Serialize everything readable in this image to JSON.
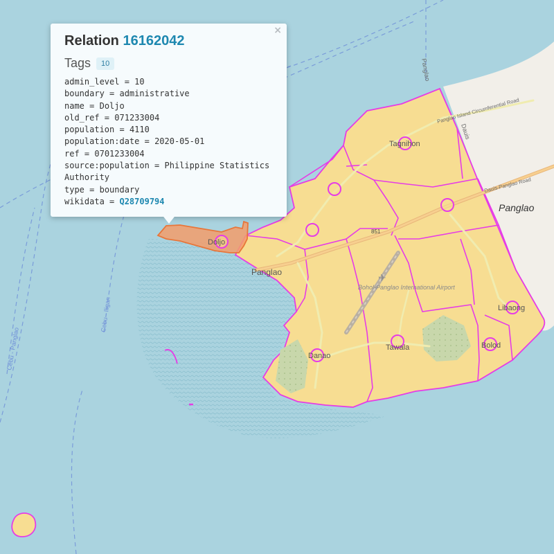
{
  "colors": {
    "water": "#aad3df",
    "land": "#f2efe9",
    "boundary_fill": "#f7dd92",
    "boundary_line": "#e63ce6",
    "selected_fill": "#f39c6b",
    "selected_line": "#e8763a",
    "link": "#1e88b0"
  },
  "map": {
    "place_labels": [
      {
        "id": "taguihon",
        "text": "Tagnihon"
      },
      {
        "id": "doljo",
        "text": "Doljo"
      },
      {
        "id": "panglao-town",
        "text": "Panglao"
      },
      {
        "id": "danao",
        "text": "Danao"
      },
      {
        "id": "tawala",
        "text": "Tawala"
      },
      {
        "id": "bolod",
        "text": "Bolod"
      },
      {
        "id": "libaong",
        "text": "Libaong"
      },
      {
        "id": "panglao-region",
        "text": "Panglao"
      }
    ],
    "road_labels": [
      {
        "id": "circumferential",
        "text": "Panglao Island Circumferential Road"
      },
      {
        "id": "dauis-panglao",
        "text": "Dauis-Panglao Road"
      },
      {
        "id": "dauis",
        "text": "Dauis"
      },
      {
        "id": "panglao-boundary",
        "text": "Panglao"
      },
      {
        "id": "airport",
        "text": "Bohol-Panglao International Airport"
      },
      {
        "id": "route",
        "text": "851"
      }
    ],
    "ferry_labels": [
      {
        "id": "cebu-iligan",
        "text": "Cebu - Iligan"
      },
      {
        "id": "cebu-panglao",
        "text": "Cebu - Panglao"
      }
    ]
  },
  "popup": {
    "title_prefix": "Relation",
    "relation_id": "16162042",
    "close_symbol": "×",
    "tags_label": "Tags",
    "tags_count": "10",
    "tags": [
      {
        "key": "admin_level",
        "value": "10"
      },
      {
        "key": "boundary",
        "value": "administrative"
      },
      {
        "key": "name",
        "value": "Doljo"
      },
      {
        "key": "old_ref",
        "value": "071233004"
      },
      {
        "key": "population",
        "value": "4110"
      },
      {
        "key": "population:date",
        "value": "2020-05-01"
      },
      {
        "key": "ref",
        "value": "0701233004"
      },
      {
        "key": "source:population",
        "value": "Philippine Statistics Authority"
      },
      {
        "key": "type",
        "value": "boundary"
      },
      {
        "key": "wikidata",
        "value": "Q28709794",
        "link": true
      }
    ]
  }
}
